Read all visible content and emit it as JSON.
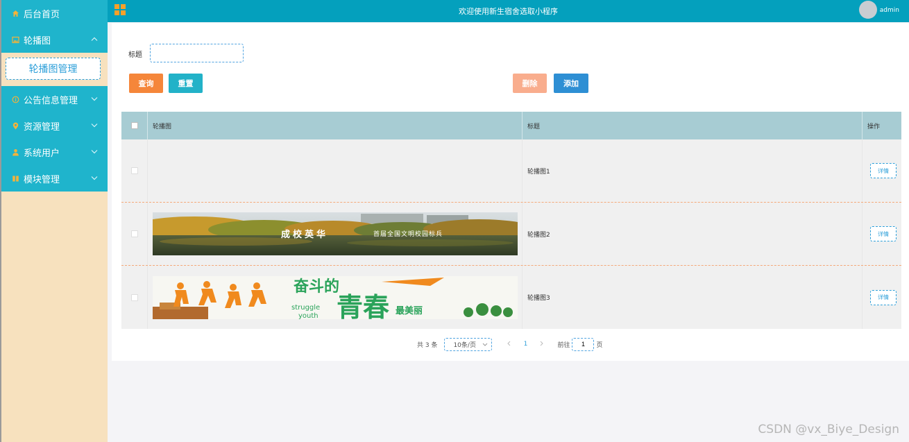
{
  "header": {
    "title": "欢迎使用新生宿舍选取小程序",
    "username": "admin"
  },
  "sidebar": {
    "items": [
      {
        "label": "后台首页",
        "icon": "home-icon"
      },
      {
        "label": "轮播图",
        "icon": "image-icon",
        "expanded": true
      },
      {
        "label": "公告信息管理",
        "icon": "info-icon"
      },
      {
        "label": "资源管理",
        "icon": "location-icon"
      },
      {
        "label": "系统用户",
        "icon": "user-icon"
      },
      {
        "label": "模块管理",
        "icon": "module-icon"
      }
    ],
    "submenu": {
      "label": "轮播图管理"
    }
  },
  "search": {
    "label": "标题",
    "value": "",
    "placeholder": ""
  },
  "buttons": {
    "query": "查询",
    "reset": "重置",
    "delete": "删除",
    "add": "添加"
  },
  "table": {
    "columns": {
      "image": "轮播图",
      "title": "标题",
      "actions": "操作"
    },
    "rows": [
      {
        "title": "轮播图1",
        "detail": "详情",
        "image": ""
      },
      {
        "title": "轮播图2",
        "detail": "详情",
        "image": "campus-banner"
      },
      {
        "title": "轮播图3",
        "detail": "详情",
        "image": "youth-banner"
      }
    ]
  },
  "banners": {
    "campus_text": "成校英华",
    "campus_subtext": "首届全国文明校园标兵",
    "youth_top": "奋斗的",
    "youth_main": "青春",
    "youth_side": "最美丽",
    "youth_en1": "struggle",
    "youth_en2": "youth"
  },
  "pagination": {
    "total": "共 3 条",
    "page_size": "10条/页",
    "current_page": "1",
    "goto_label": "前往",
    "goto_value": "1",
    "page_unit": "页"
  },
  "watermark": "CSDN @vx_Biye_Design",
  "colors": {
    "header": "#04a0bd",
    "menu": "#1fb4cc",
    "sidebar_bg": "#f7e1be",
    "query": "#f5863a",
    "reset": "#22b2c8",
    "delete": "#f9ad8d",
    "add": "#2e8fd4",
    "table_header": "#a7ccd3"
  }
}
